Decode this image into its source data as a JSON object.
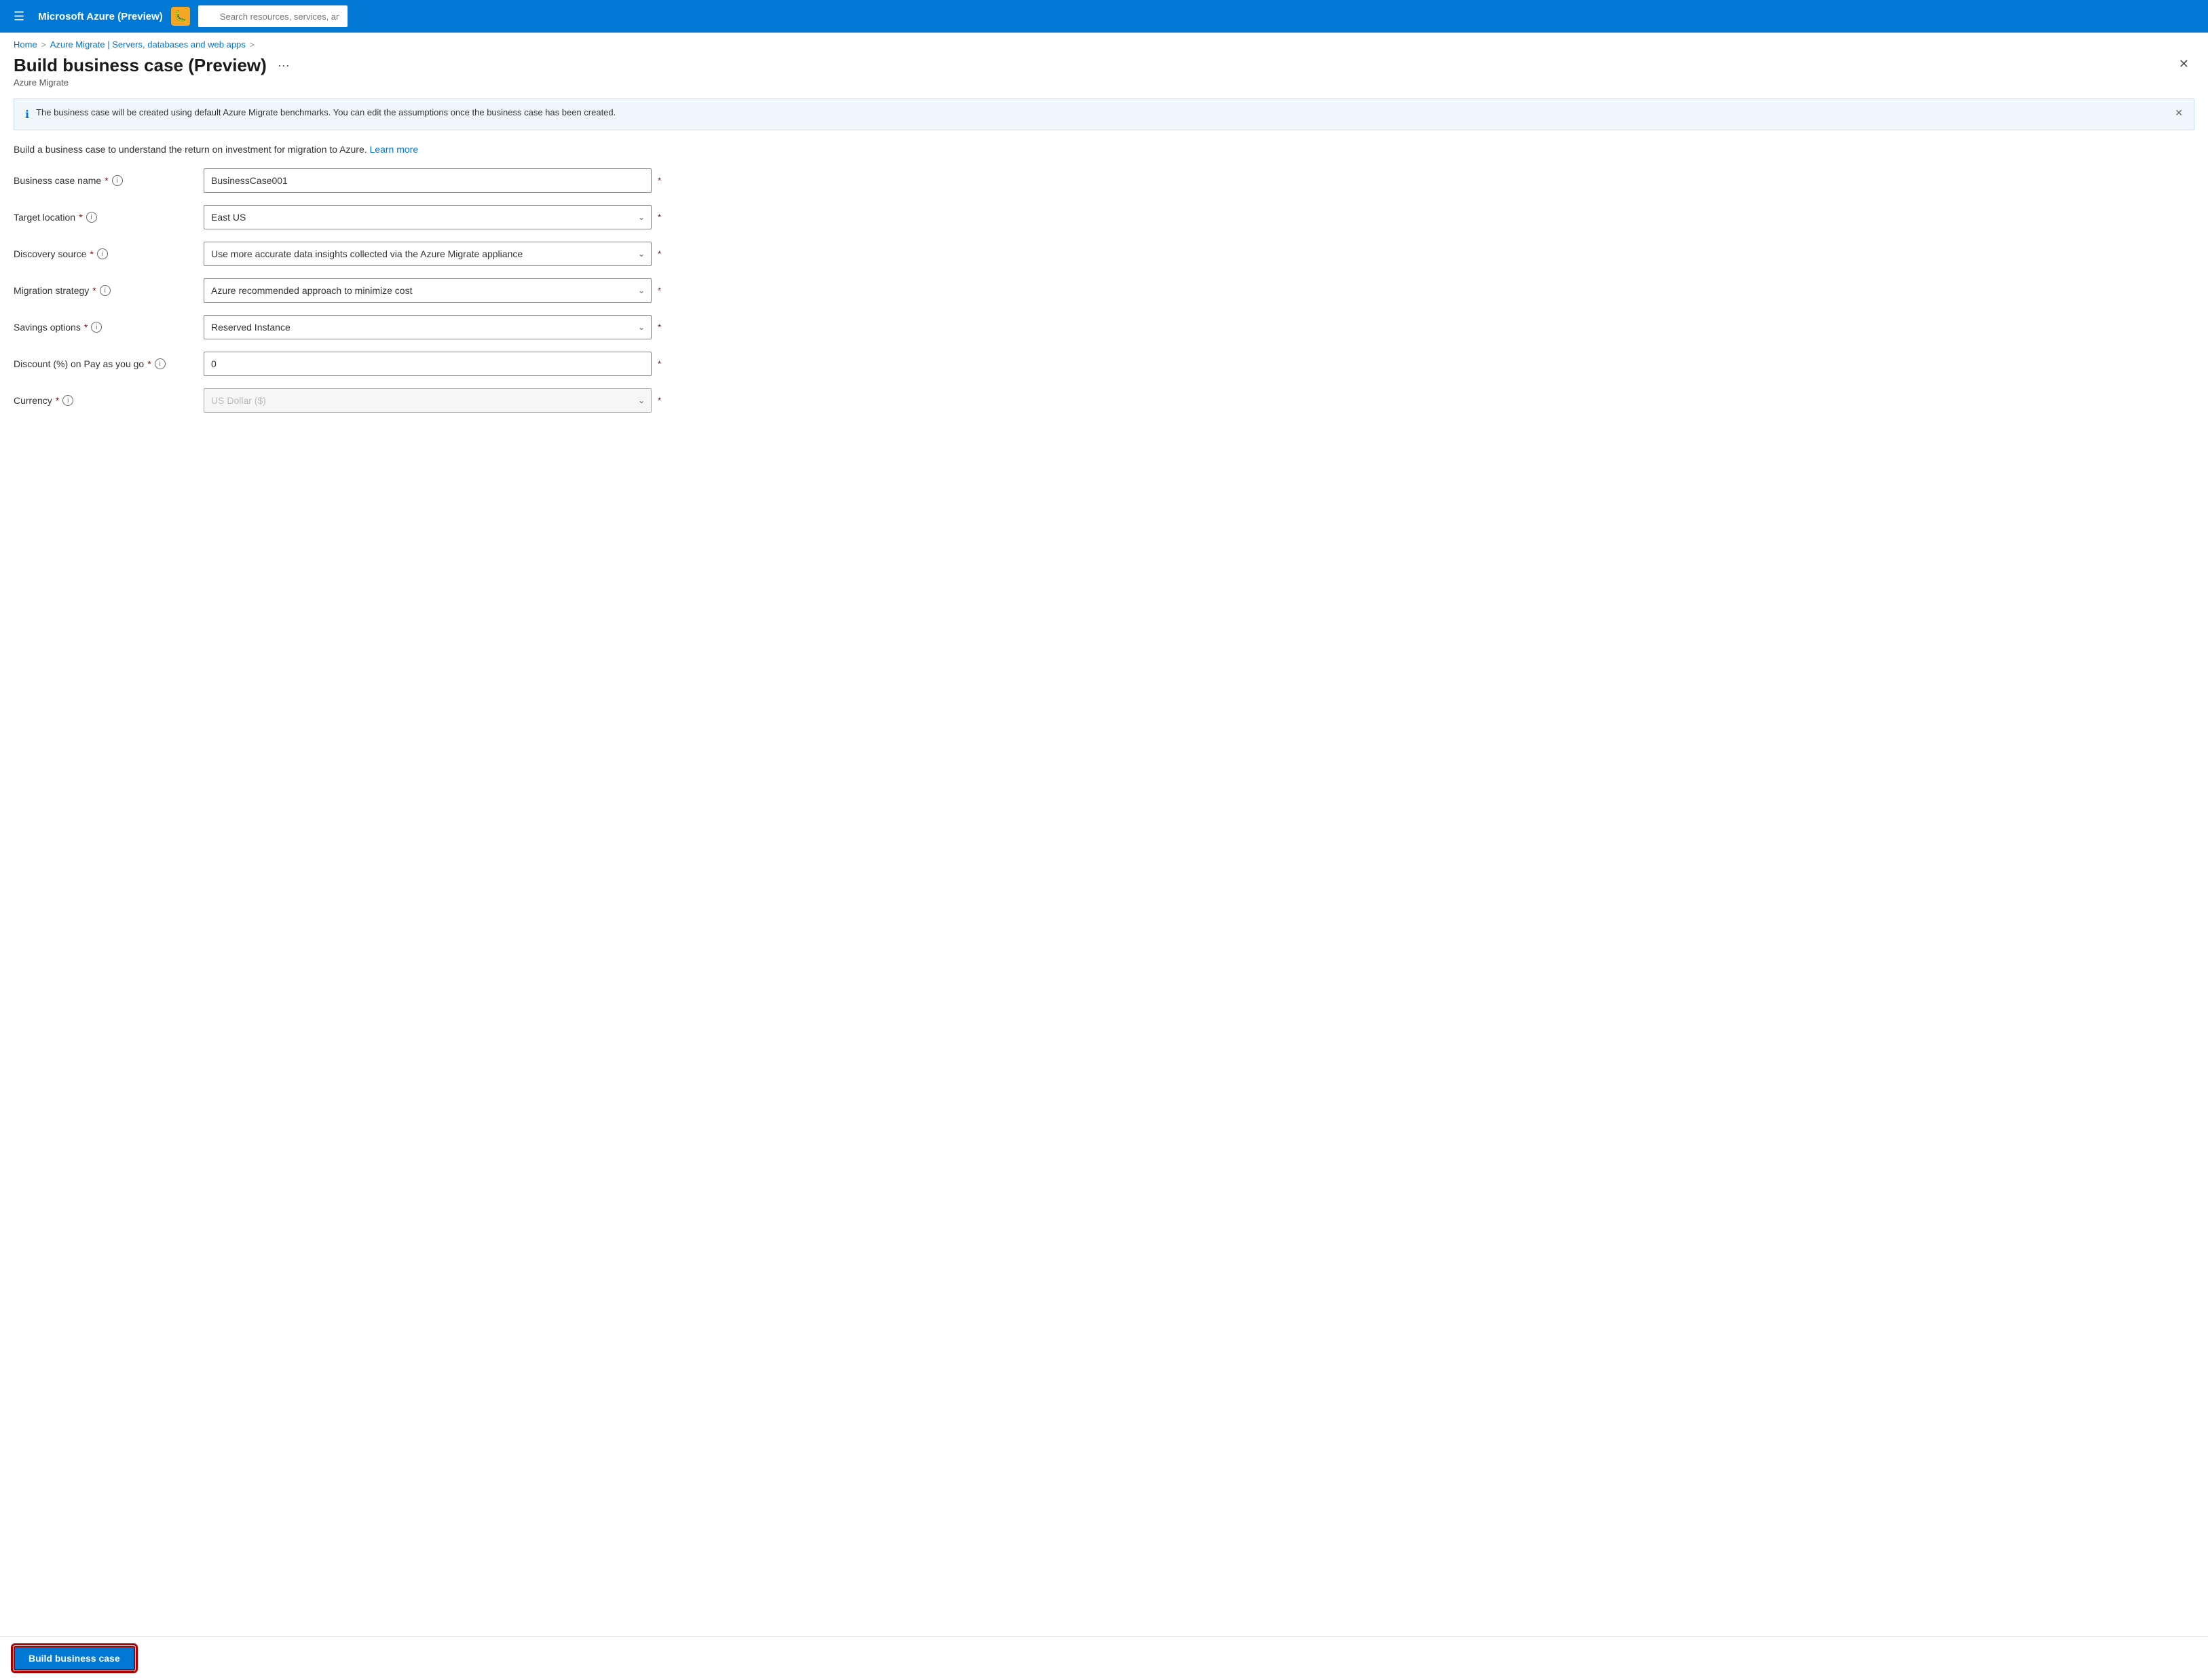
{
  "topbar": {
    "hamburger_icon": "☰",
    "title": "Microsoft Azure (Preview)",
    "bug_icon": "🐛",
    "search_placeholder": "Search resources, services, and docs (G+/)"
  },
  "breadcrumb": {
    "home": "Home",
    "sep1": ">",
    "azure_migrate": "Azure Migrate | Servers, databases and web apps",
    "sep2": ">"
  },
  "page": {
    "title": "Build business case (Preview)",
    "subtitle": "Azure Migrate",
    "more_label": "···"
  },
  "info_banner": {
    "text": "The business case will be created using default Azure Migrate benchmarks. You can edit the assumptions once the business case has been created."
  },
  "description": {
    "text": "Build a business case to understand the return on investment for migration to Azure.",
    "learn_more": "Learn more"
  },
  "form": {
    "fields": [
      {
        "label": "Business case name",
        "type": "input",
        "value": "BusinessCase001",
        "placeholder": ""
      },
      {
        "label": "Target location",
        "type": "select",
        "value": "East US",
        "disabled": false
      },
      {
        "label": "Discovery source",
        "type": "select",
        "value": "Use more accurate data insights collected via the Azure Migrate appliance",
        "disabled": false
      },
      {
        "label": "Migration strategy",
        "type": "select",
        "value": "Azure recommended approach to minimize cost",
        "disabled": false
      },
      {
        "label": "Savings options",
        "type": "select",
        "value": "Reserved Instance",
        "disabled": false
      },
      {
        "label": "Discount (%) on Pay as you go",
        "type": "input",
        "value": "0",
        "placeholder": ""
      },
      {
        "label": "Currency",
        "type": "select",
        "value": "US Dollar ($)",
        "disabled": true
      }
    ]
  },
  "footer": {
    "build_button": "Build business case"
  }
}
